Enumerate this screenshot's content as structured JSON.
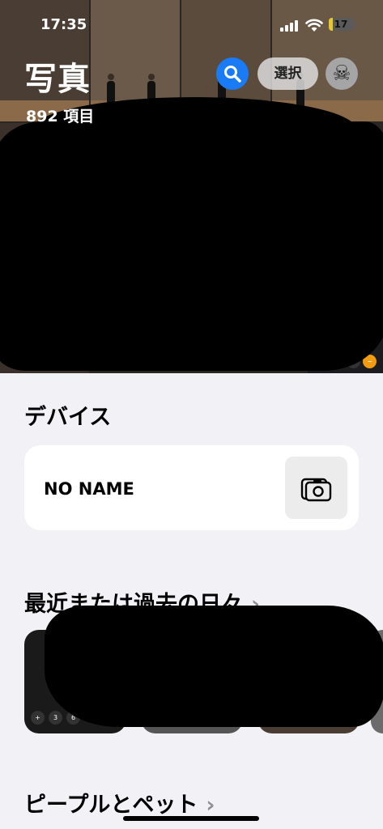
{
  "status_bar": {
    "time": "17:35",
    "battery": "17",
    "battery_level_percent": 17
  },
  "header": {
    "title": "写真",
    "count": "892 項目",
    "select_label": "選択",
    "search_icon": "search-icon",
    "avatar_icon": "skull-crossbones-icon"
  },
  "devices": {
    "title": "デバイス",
    "items": [
      {
        "name": "NO NAME",
        "icon": "camera-folder-icon"
      }
    ]
  },
  "memories": {
    "title": "最近または過去の日々"
  },
  "people": {
    "title": "ピープルとペット"
  },
  "colors": {
    "accent": "#1a7bf7",
    "background": "#f2f1f6",
    "battery": "#e8c72c"
  }
}
